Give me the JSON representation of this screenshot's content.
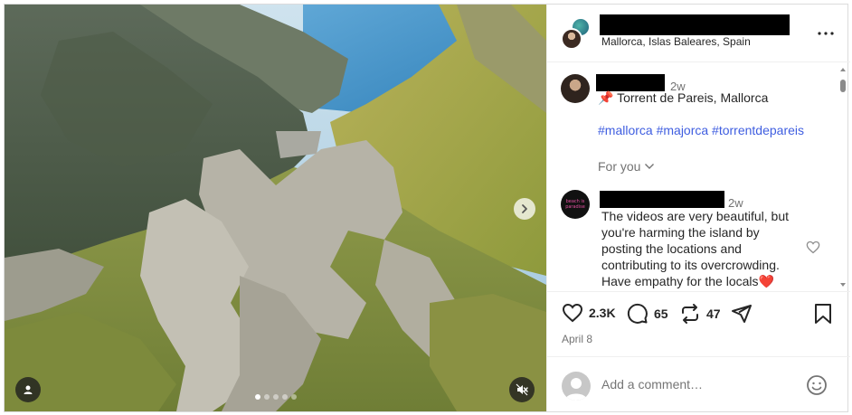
{
  "post": {
    "location": "Mallorca, Islas Baleares, Spain",
    "caption": {
      "time": "2w",
      "text": "📌 Torrent de Pareis, Mallorca",
      "hashtags": "#mallorca #majorca #torrentdepareis",
      "for_you": "For you"
    },
    "comment": {
      "time": "2w",
      "text": "The videos are very beautiful, but you're harming the island by posting the locations and contributing to its overcrowding. Have empathy for the locals❤️"
    },
    "stats": {
      "likes": "2.3K",
      "comments": "65",
      "reposts": "47"
    },
    "date": "April 8",
    "add_comment_placeholder": "Add a comment…",
    "carousel": {
      "count": 5,
      "active_index": 0
    }
  },
  "icons": {
    "more": "more-horizontal-icon",
    "next": "chevron-right-icon",
    "user_tag": "user-tag-icon",
    "mute": "speaker-muted-icon",
    "like": "heart-icon",
    "comment": "comment-bubble-icon",
    "repost": "repost-icon",
    "share": "send-icon",
    "save": "bookmark-icon",
    "emoji": "emoji-icon"
  }
}
